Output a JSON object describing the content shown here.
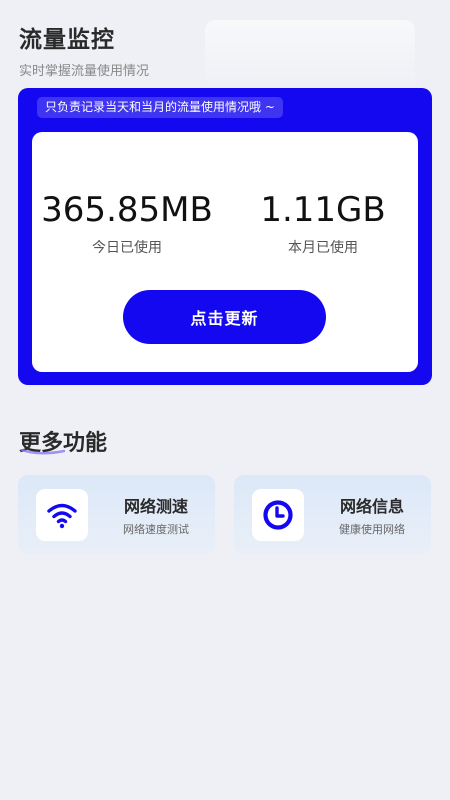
{
  "header": {
    "title": "流量监控",
    "subtitle": "实时掌握流量使用情况"
  },
  "usage_card": {
    "notice": "只负责记录当天和当月的流量使用情况哦 ~",
    "today": {
      "value": "365.85MB",
      "label": "今日已使用"
    },
    "month": {
      "value": "1.11GB",
      "label": "本月已使用"
    },
    "refresh_label": "点击更新"
  },
  "more": {
    "title": "更多功能",
    "items": [
      {
        "title": "网络测速",
        "subtitle": "网络速度测试",
        "icon": "wifi-icon"
      },
      {
        "title": "网络信息",
        "subtitle": "健康使用网络",
        "icon": "clock-icon"
      }
    ]
  },
  "colors": {
    "accent": "#1408f0",
    "background": "#eef0f5"
  }
}
